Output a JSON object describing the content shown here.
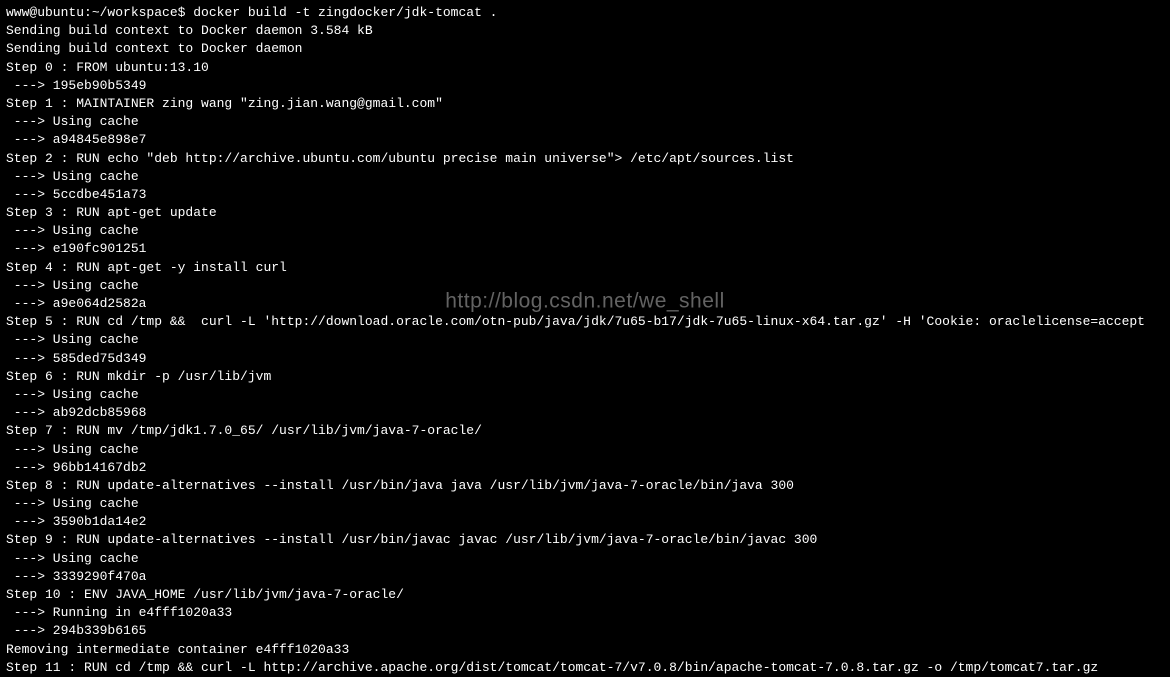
{
  "prompt": {
    "user_host": "www@ubuntu",
    "path": ":~/workspace$",
    "command": " docker build -t zingdocker/jdk-tomcat ."
  },
  "lines": [
    "Sending build context to Docker daemon 3.584 kB",
    "Sending build context to Docker daemon",
    "Step 0 : FROM ubuntu:13.10",
    " ---> 195eb90b5349",
    "Step 1 : MAINTAINER zing wang \"zing.jian.wang@gmail.com\"",
    " ---> Using cache",
    " ---> a94845e898e7",
    "Step 2 : RUN echo \"deb http://archive.ubuntu.com/ubuntu precise main universe\"> /etc/apt/sources.list",
    " ---> Using cache",
    " ---> 5ccdbe451a73",
    "Step 3 : RUN apt-get update",
    " ---> Using cache",
    " ---> e190fc901251",
    "Step 4 : RUN apt-get -y install curl",
    " ---> Using cache",
    " ---> a9e064d2582a",
    "Step 5 : RUN cd /tmp &&  curl -L 'http://download.oracle.com/otn-pub/java/jdk/7u65-b17/jdk-7u65-linux-x64.tar.gz' -H 'Cookie: oraclelicense=accept",
    " ---> Using cache",
    " ---> 585ded75d349",
    "Step 6 : RUN mkdir -p /usr/lib/jvm",
    " ---> Using cache",
    " ---> ab92dcb85968",
    "Step 7 : RUN mv /tmp/jdk1.7.0_65/ /usr/lib/jvm/java-7-oracle/",
    " ---> Using cache",
    " ---> 96bb14167db2",
    "Step 8 : RUN update-alternatives --install /usr/bin/java java /usr/lib/jvm/java-7-oracle/bin/java 300",
    " ---> Using cache",
    " ---> 3590b1da14e2",
    "Step 9 : RUN update-alternatives --install /usr/bin/javac javac /usr/lib/jvm/java-7-oracle/bin/javac 300",
    " ---> Using cache",
    " ---> 3339290f470a",
    "Step 10 : ENV JAVA_HOME /usr/lib/jvm/java-7-oracle/",
    " ---> Running in e4fff1020a33",
    " ---> 294b339b6165",
    "Removing intermediate container e4fff1020a33",
    "Step 11 : RUN cd /tmp && curl -L http://archive.apache.org/dist/tomcat/tomcat-7/v7.0.8/bin/apache-tomcat-7.0.8.tar.gz -o /tmp/tomcat7.tar.gz"
  ],
  "watermark": "http://blog.csdn.net/we_shell"
}
